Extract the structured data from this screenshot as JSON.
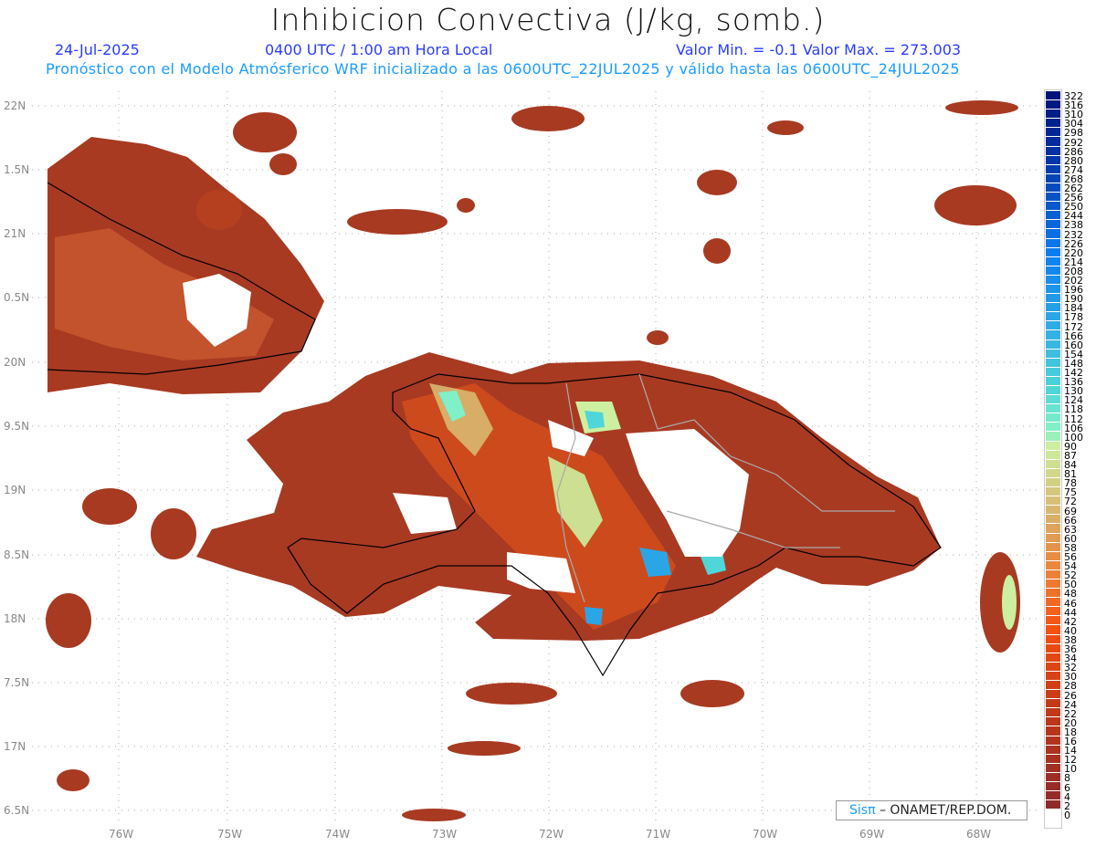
{
  "header": {
    "title": "Inhibicion Convectiva (J/kg, somb.)",
    "date": "24-Jul-2025",
    "time": "0400 UTC / 1:00 am Hora Local",
    "minmax": "Valor Min. = -0.1  Valor Max. = 273.003",
    "forecast": "Pronóstico con el Modelo Atmósferico WRF inicializado a las 0600UTC_22JUL2025 y válido hasta las  0600UTC_24JUL2025"
  },
  "axes": {
    "lat_labels": [
      "22N",
      "1.5N",
      "21N",
      "0.5N",
      "20N",
      "9.5N",
      "19N",
      "8.5N",
      "18N",
      "7.5N",
      "17N",
      "6.5N"
    ],
    "lon_labels": [
      "76W",
      "75W",
      "74W",
      "73W",
      "72W",
      "71W",
      "70W",
      "69W",
      "68W"
    ]
  },
  "colorbar": {
    "labels": [
      "322",
      "316",
      "310",
      "304",
      "298",
      "292",
      "286",
      "280",
      "274",
      "268",
      "262",
      "256",
      "250",
      "244",
      "238",
      "232",
      "226",
      "220",
      "214",
      "208",
      "202",
      "196",
      "190",
      "184",
      "178",
      "172",
      "166",
      "160",
      "154",
      "148",
      "142",
      "136",
      "130",
      "124",
      "118",
      "112",
      "106",
      "100",
      "90",
      "87",
      "84",
      "81",
      "78",
      "75",
      "72",
      "69",
      "66",
      "63",
      "60",
      "58",
      "56",
      "54",
      "52",
      "50",
      "48",
      "46",
      "44",
      "42",
      "40",
      "38",
      "36",
      "34",
      "32",
      "30",
      "28",
      "26",
      "24",
      "22",
      "20",
      "18",
      "16",
      "14",
      "12",
      "10",
      "8",
      "6",
      "4",
      "2",
      "0"
    ],
    "color_stops": [
      {
        "v": 322,
        "c": "#00137a"
      },
      {
        "v": 280,
        "c": "#0336a8"
      },
      {
        "v": 220,
        "c": "#0a7ef0"
      },
      {
        "v": 178,
        "c": "#2aa6e6"
      },
      {
        "v": 130,
        "c": "#4fd6d8"
      },
      {
        "v": 106,
        "c": "#7ff0c8"
      },
      {
        "v": 90,
        "c": "#ccf0a0"
      },
      {
        "v": 69,
        "c": "#d8b870"
      },
      {
        "v": 50,
        "c": "#ee7a30"
      },
      {
        "v": 40,
        "c": "#f45010"
      },
      {
        "v": 24,
        "c": "#c43a18"
      },
      {
        "v": 2,
        "c": "#8e2a2a"
      },
      {
        "v": 0,
        "c": "#ffffff"
      }
    ]
  },
  "credit": {
    "brand": "Sisπ",
    "text": "– ONAMET/REP.DOM."
  }
}
